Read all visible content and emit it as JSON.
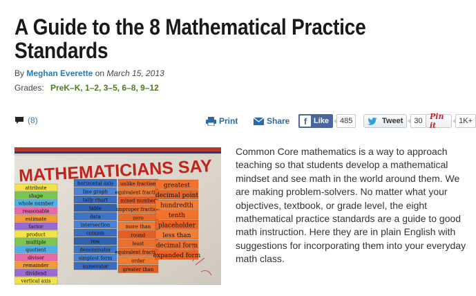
{
  "article": {
    "title": "A Guide to the 8 Mathematical Practice Standards",
    "byline_prefix": "By",
    "author": "Meghan Everette",
    "date_prefix": "on",
    "date": "March 15, 2013",
    "grades_label": "Grades:",
    "grades": "PreK–K, 1–2, 3–5, 6–8, 9–12",
    "comment_count": "(8)",
    "body": "Common Core mathematics is a way to approach teaching so that students develop a mathematical mindset and see math in the world around them. We are making problem-solvers. No matter what your objectives, textbook, or grade level, the eight mathematical practice standards are a guide to good math instruction. Here they are in plain English with suggestions for incorporating them into your everyday math class."
  },
  "share": {
    "print_label": "Print",
    "share_label": "Share",
    "like_label": "Like",
    "like_count": "485",
    "tweet_label": "Tweet",
    "tweet_count": "30",
    "pin_label": "Pin it",
    "pin_count": "1K+"
  },
  "photo": {
    "banner": "MATHEMATICIANS SAY",
    "col1": [
      "horizontal axis",
      "line graph",
      "tally chart",
      "table",
      "data",
      "intersection",
      "column",
      "row",
      "denominator",
      "simplest form",
      "numerator"
    ],
    "col2": [
      "unlike fraction",
      "equivalent fraction",
      "mixed number",
      "improper fraction",
      "zero",
      "more than",
      "round",
      "least",
      "equivalent fraction",
      "order",
      "greater than"
    ],
    "col3": [
      "greatest",
      "decimal point",
      "hundredth",
      "tenth",
      "placeholder",
      "less than",
      "decimal form",
      "expanded form"
    ],
    "col0": [
      "attribute",
      "shape",
      "whole number",
      "reasonable",
      "estimate",
      "factor",
      "product",
      "multiple",
      "quotient",
      "divisor",
      "remainder",
      "dividend",
      "vertical axis"
    ]
  },
  "colors": {
    "link": "#2a7ab8",
    "grades": "#4c7a1a",
    "facebook": "#4a66a0",
    "pinterest": "#c8232c"
  }
}
